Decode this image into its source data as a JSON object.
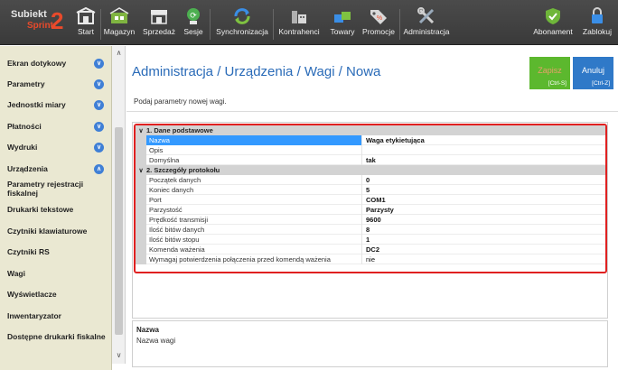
{
  "app": {
    "logo_line1": "Subiekt",
    "logo_line2": "Sprint",
    "logo_version": "2"
  },
  "toolbar": {
    "left": [
      {
        "id": "start",
        "label": "Start",
        "icon": "home-icon"
      },
      {
        "id": "magazyn",
        "label": "Magazyn",
        "icon": "warehouse-icon"
      },
      {
        "id": "sprzedaz",
        "label": "Sprzedaż",
        "icon": "shop-icon"
      },
      {
        "id": "sesje",
        "label": "Sesje",
        "icon": "session-icon"
      },
      {
        "id": "synchronizacja",
        "label": "Synchronizacja",
        "icon": "sync-icon"
      },
      {
        "id": "kontrahenci",
        "label": "Kontrahenci",
        "icon": "contractors-icon"
      },
      {
        "id": "towary",
        "label": "Towary",
        "icon": "goods-icon"
      },
      {
        "id": "promocje",
        "label": "Promocje",
        "icon": "promotion-tag-icon"
      },
      {
        "id": "administracja",
        "label": "Administracja",
        "icon": "admin-tools-icon"
      }
    ],
    "right": [
      {
        "id": "abonament",
        "label": "Abonament",
        "icon": "shield-check-icon"
      },
      {
        "id": "zablokuj",
        "label": "Zablokuj",
        "icon": "lock-icon"
      }
    ]
  },
  "sidebar": {
    "items": [
      {
        "label": "Ekran dotykowy",
        "chevron": "down"
      },
      {
        "label": "Parametry",
        "chevron": "down"
      },
      {
        "label": "Jednostki miary",
        "chevron": "down"
      },
      {
        "label": "Płatności",
        "chevron": "down"
      },
      {
        "label": "Wydruki",
        "chevron": "down"
      },
      {
        "label": "Urządzenia",
        "chevron": "up"
      }
    ],
    "subitems": [
      "Parametry rejestracji fiskalnej",
      "Drukarki tekstowe",
      "Czytniki klawiaturowe",
      "Czytniki RS",
      "Wagi",
      "Wyświetlacze",
      "Inwentaryzator",
      "Dostępne drukarki fiskalne"
    ]
  },
  "main": {
    "breadcrumb": "Administracja / Urządzenia / Wagi / Nowa",
    "subtitle": "Podaj parametry nowej wagi.",
    "save_button": {
      "label": "Zapisz",
      "shortcut": "[Ctrl-S]",
      "color": "#5cb82e",
      "label_color": "#e9a06a"
    },
    "cancel_button": {
      "label": "Anuluj",
      "shortcut": "[Ctrl-Z]",
      "color": "#2f79c8",
      "label_color": "#ffffff"
    },
    "property_grid": {
      "sections": [
        {
          "title": "1. Dane podstawowe",
          "rows": [
            {
              "name": "Nazwa",
              "value": "Waga etykietująca",
              "selected": true
            },
            {
              "name": "Opis",
              "value": ""
            },
            {
              "name": "Domyślna",
              "value": "tak"
            }
          ]
        },
        {
          "title": "2. Szczegóły protokołu",
          "rows": [
            {
              "name": "Początek danych",
              "value": "0"
            },
            {
              "name": "Koniec danych",
              "value": "5"
            },
            {
              "name": "Port",
              "value": "COM1"
            },
            {
              "name": "Parzystość",
              "value": "Parzysty"
            },
            {
              "name": "Prędkość transmisji",
              "value": "9600"
            },
            {
              "name": "Ilość bitów danych",
              "value": "8"
            },
            {
              "name": "Ilość bitów stopu",
              "value": "1"
            },
            {
              "name": "Komenda ważenia",
              "value": "DC2"
            },
            {
              "name": "Wymagaj potwierdzenia połączenia przed komendą ważenia",
              "value": "nie",
              "plain": true
            }
          ]
        }
      ]
    },
    "description": {
      "title": "Nazwa",
      "text": "Nazwa wagi"
    }
  },
  "colors": {
    "accent": "#2a6bb8",
    "toolbar_bg": "#444444",
    "sidebar_bg": "#eae8d2",
    "highlight": "#e02020",
    "selection": "#3399ff"
  }
}
